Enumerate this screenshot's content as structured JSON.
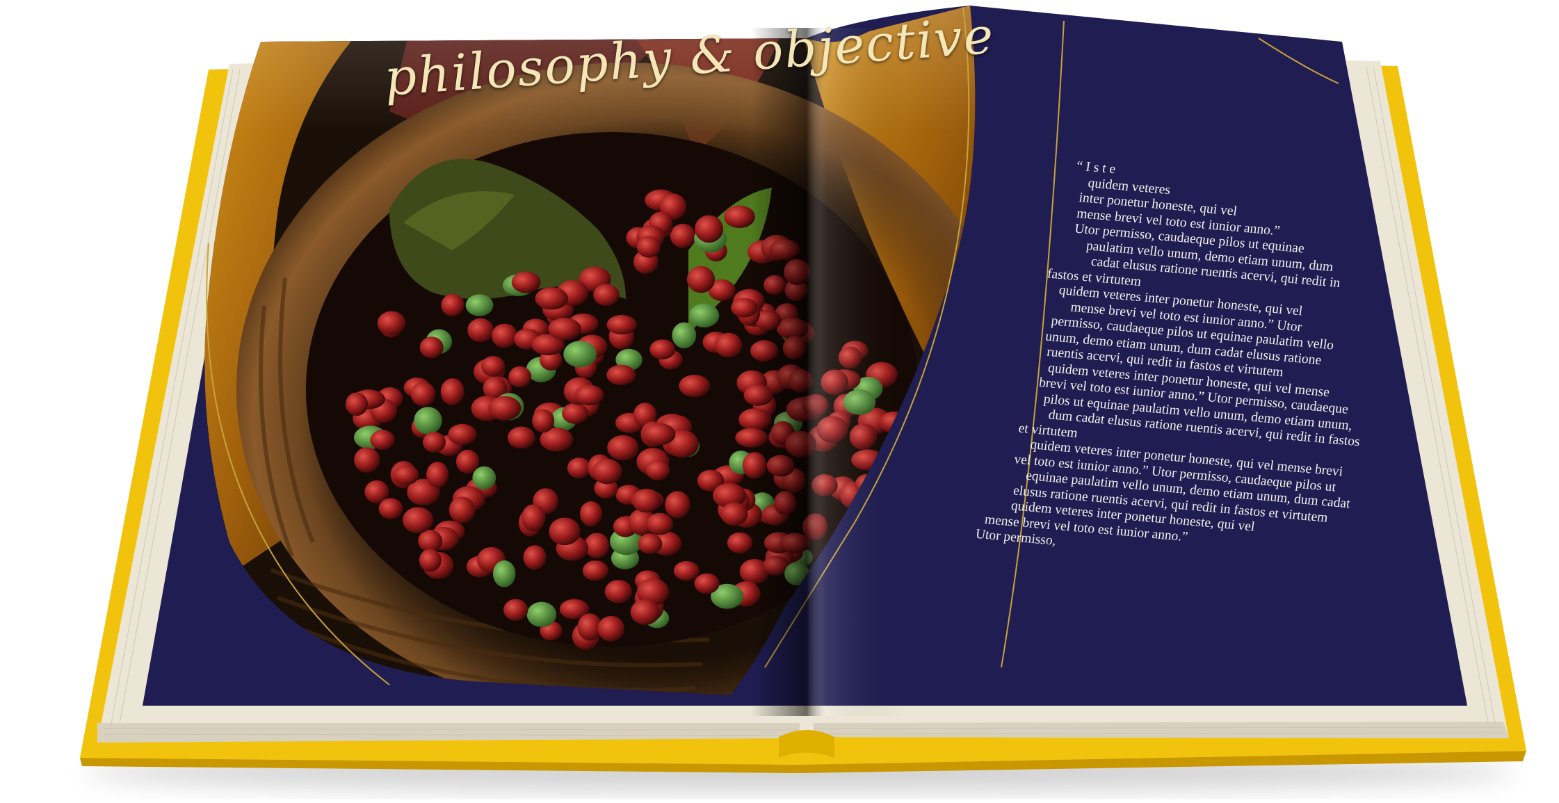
{
  "book": {
    "title": "philosophy & objective",
    "colors": {
      "cover": "#f1c30c",
      "cover_shadow": "#c99700",
      "page_navy": "#1f1d52",
      "gold_rule": "#c8a23a",
      "text": "#f2f0ea",
      "title": "#f5e6b8"
    },
    "quote_lines": [
      "“ I s t e",
      "quidem  veteres",
      "inter ponetur honeste, qui vel",
      "mense brevi vel toto est iunior anno.”",
      "Utor permisso, caudaeque pilos ut equinae",
      "paulatim vello unum, demo etiam unum, dum",
      "cadat elusus ratione ruentis acervi, qui redit in",
      "fastos et virtutem",
      "quidem veteres inter ponetur honeste, qui vel",
      "mense brevi vel toto est iunior anno.” Utor",
      "permisso, caudaeque pilos ut equinae paulatim vello",
      "unum, demo etiam unum, dum cadat elusus ratione",
      "ruentis acervi, qui redit in fastos et virtutem",
      "quidem veteres inter ponetur honeste, qui vel mense",
      "brevi vel toto est iunior anno.” Utor permisso, caudaeque",
      "pilos ut equinae paulatim vello unum, demo etiam unum,",
      "dum cadat elusus ratione ruentis acervi, qui redit in fastos",
      "et virtutem",
      "quidem veteres inter ponetur honeste, qui vel mense brevi",
      "vel toto est iunior anno.” Utor permisso, caudaeque pilos ut",
      "equinae paulatim vello unum, demo etiam unum, dum cadat",
      "elusus ratione ruentis acervi, qui redit in fastos et virtutem",
      "quidem veteres inter ponetur honeste, qui vel",
      "mense brevi vel toto est iunior anno.”",
      "Utor  permisso,"
    ]
  }
}
